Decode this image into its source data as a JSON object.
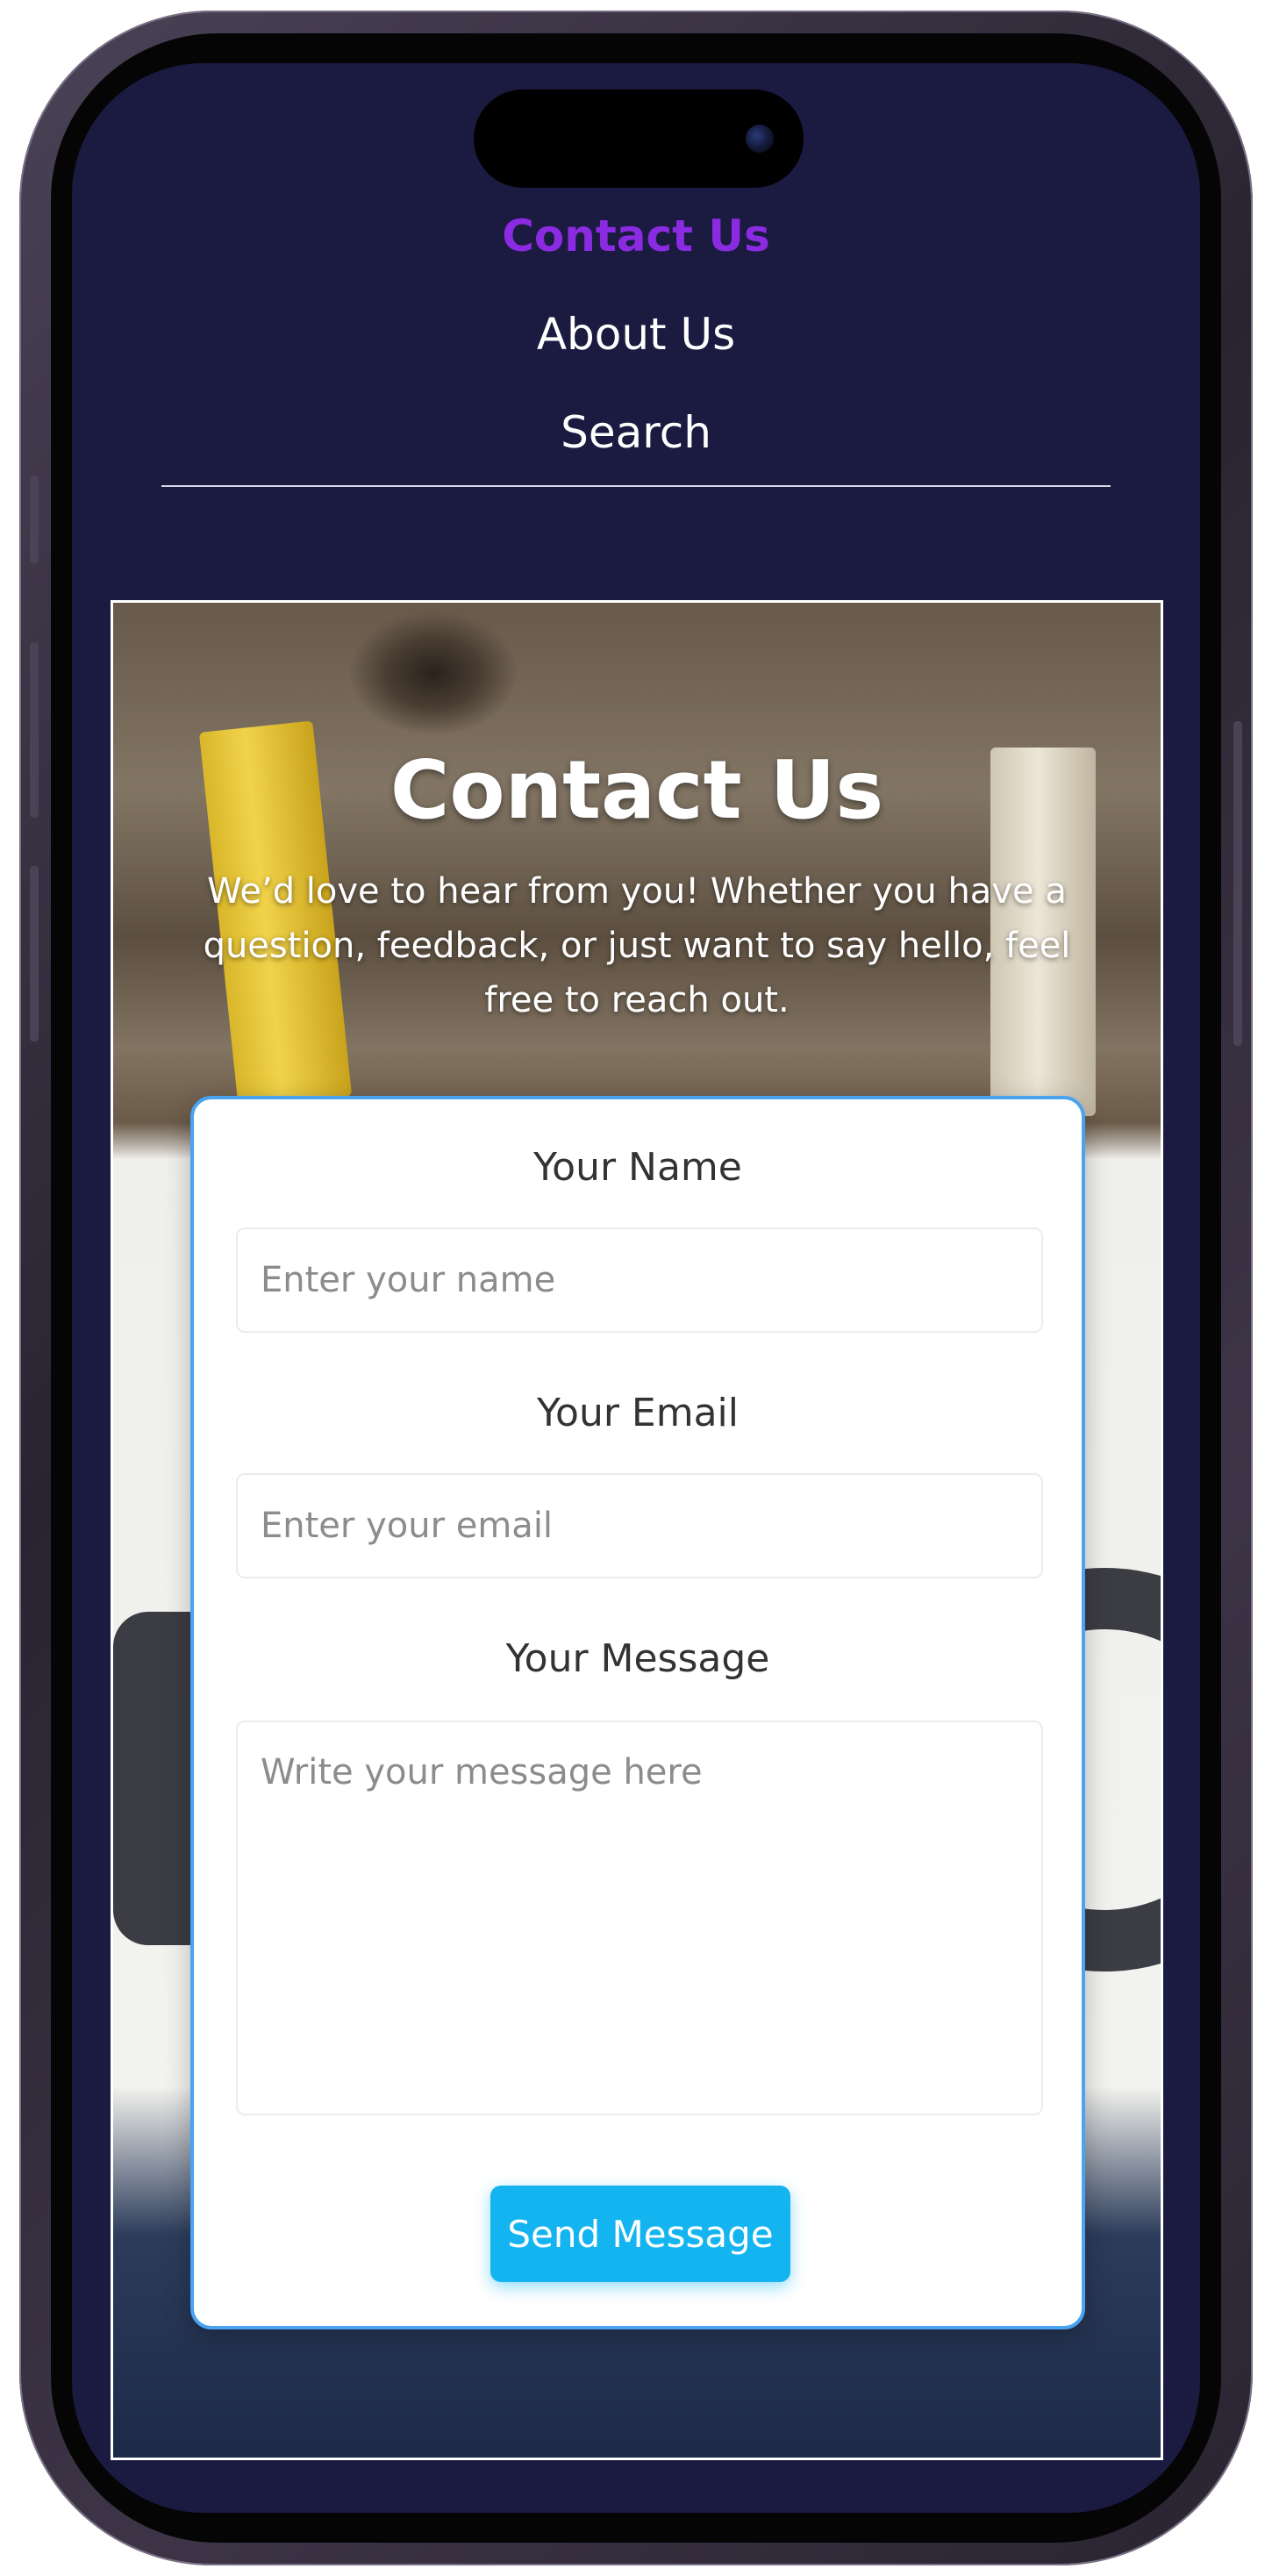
{
  "nav": {
    "items": [
      {
        "label": "Contact Us",
        "active": true
      },
      {
        "label": "About Us",
        "active": false
      },
      {
        "label": "Search",
        "active": false
      }
    ],
    "active_color": "#8a2be2"
  },
  "hero": {
    "title": "Contact Us",
    "subtitle": "We’d love to hear from you! Whether you have a question, feedback, or just want to say hello, feel free to reach out."
  },
  "form": {
    "name": {
      "label": "Your Name",
      "placeholder": "Enter your name",
      "value": ""
    },
    "email": {
      "label": "Your Email",
      "placeholder": "Enter your email",
      "value": ""
    },
    "message": {
      "label": "Your Message",
      "placeholder": "Write your message here",
      "value": ""
    },
    "submit_label": "Send Message"
  },
  "colors": {
    "background": "#1b1a40",
    "button": "#14b4f0",
    "card_border": "#4aa3f0"
  }
}
